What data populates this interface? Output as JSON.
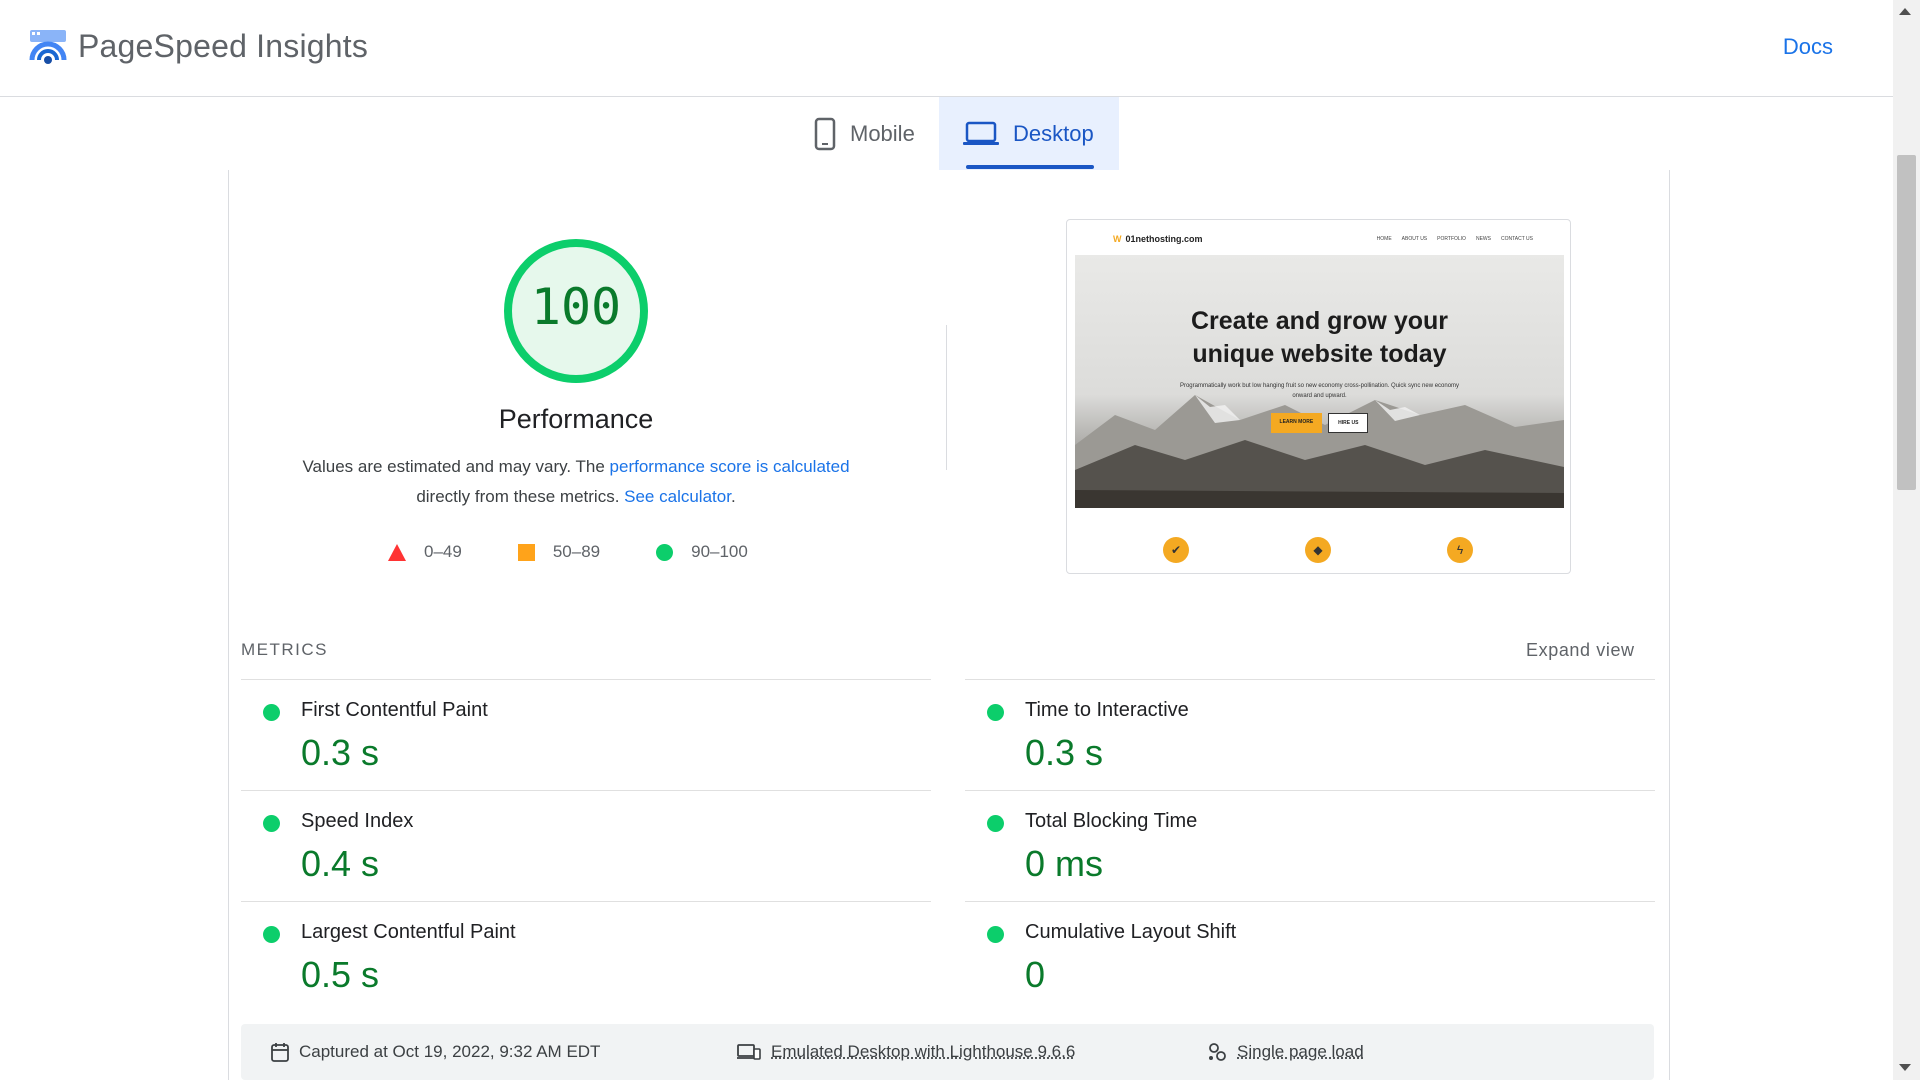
{
  "header": {
    "brand": "PageSpeed Insights",
    "docs_label": "Docs"
  },
  "tabs": [
    {
      "label": "Mobile",
      "icon": "phone-icon",
      "active": false
    },
    {
      "label": "Desktop",
      "icon": "laptop-icon",
      "active": true
    }
  ],
  "performance": {
    "score": "100",
    "title": "Performance",
    "desc_prefix": "Values are estimated and may vary. The ",
    "desc_link": "performance score is calculated",
    "desc_middle": " directly from these metrics. ",
    "desc_link2": "See calculator",
    "desc_suffix": "."
  },
  "legend": [
    {
      "label": "0–49",
      "shape": "triangle",
      "color": "#ff3333"
    },
    {
      "label": "50–89",
      "shape": "square",
      "color": "#ffa31a"
    },
    {
      "label": "90–100",
      "shape": "circle",
      "color": "#0cce6b"
    }
  ],
  "screenshot": {
    "site_name": "01nethosting.com",
    "nav_links": [
      "HOME",
      "ABOUT US",
      "PORTFOLIO",
      "NEWS",
      "CONTACT US"
    ],
    "hero_title_line1": "Create and grow your",
    "hero_title_line2": "unique website today",
    "hero_sub": "Programmatically work but low hanging fruit so new economy cross-pollination. Quick sync new economy onward and upward.",
    "btn_primary": "LEARN MORE",
    "btn_secondary": "HIRE US"
  },
  "metrics": {
    "label": "METRICS",
    "expand_label": "Expand view",
    "left": [
      {
        "name": "First Contentful Paint",
        "value": "0.3 s"
      },
      {
        "name": "Speed Index",
        "value": "0.4 s"
      },
      {
        "name": "Largest Contentful Paint",
        "value": "0.5 s"
      }
    ],
    "right": [
      {
        "name": "Time to Interactive",
        "value": "0.3 s"
      },
      {
        "name": "Total Blocking Time",
        "value": "0 ms"
      },
      {
        "name": "Cumulative Layout Shift",
        "value": "0"
      }
    ]
  },
  "footer": {
    "captured": "Captured at Oct 19, 2022, 9:32 AM EDT",
    "emulated": "Emulated Desktop with Lighthouse 9.6.6",
    "load": "Single page load"
  },
  "colors": {
    "good": "#0cce6b",
    "good_text": "#0a7a2b",
    "accent": "#1a73e8"
  }
}
